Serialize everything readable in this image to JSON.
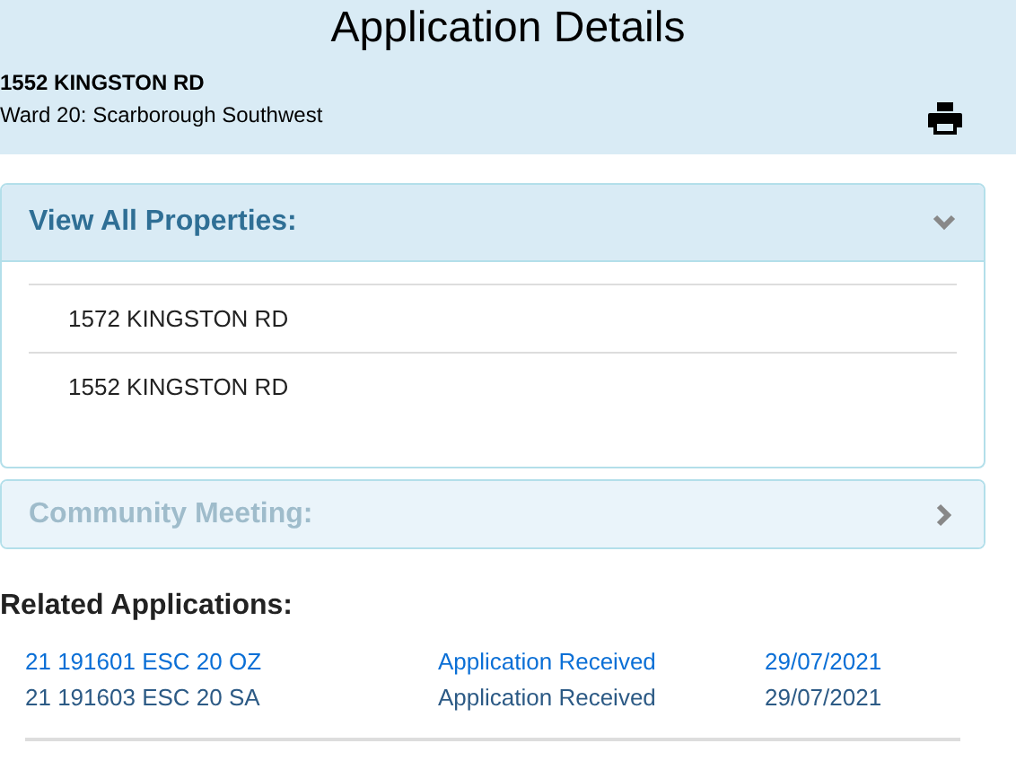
{
  "header": {
    "title": "Application Details",
    "address": "1552 KINGSTON RD",
    "ward": "Ward 20: Scarborough Southwest"
  },
  "panels": [
    {
      "title": "View All Properties:",
      "expanded": true,
      "disabled": false,
      "items": [
        "1572 KINGSTON RD",
        "1552 KINGSTON RD"
      ]
    },
    {
      "title": "Community Meeting:",
      "expanded": false,
      "disabled": true
    }
  ],
  "related": {
    "heading": "Related Applications:",
    "rows": [
      {
        "number": "21 191601 ESC 20 OZ",
        "status": "Application Received",
        "date": "29/07/2021",
        "active": true
      },
      {
        "number": "21 191603 ESC 20 SA",
        "status": "Application Received",
        "date": "29/07/2021",
        "active": false
      }
    ]
  }
}
